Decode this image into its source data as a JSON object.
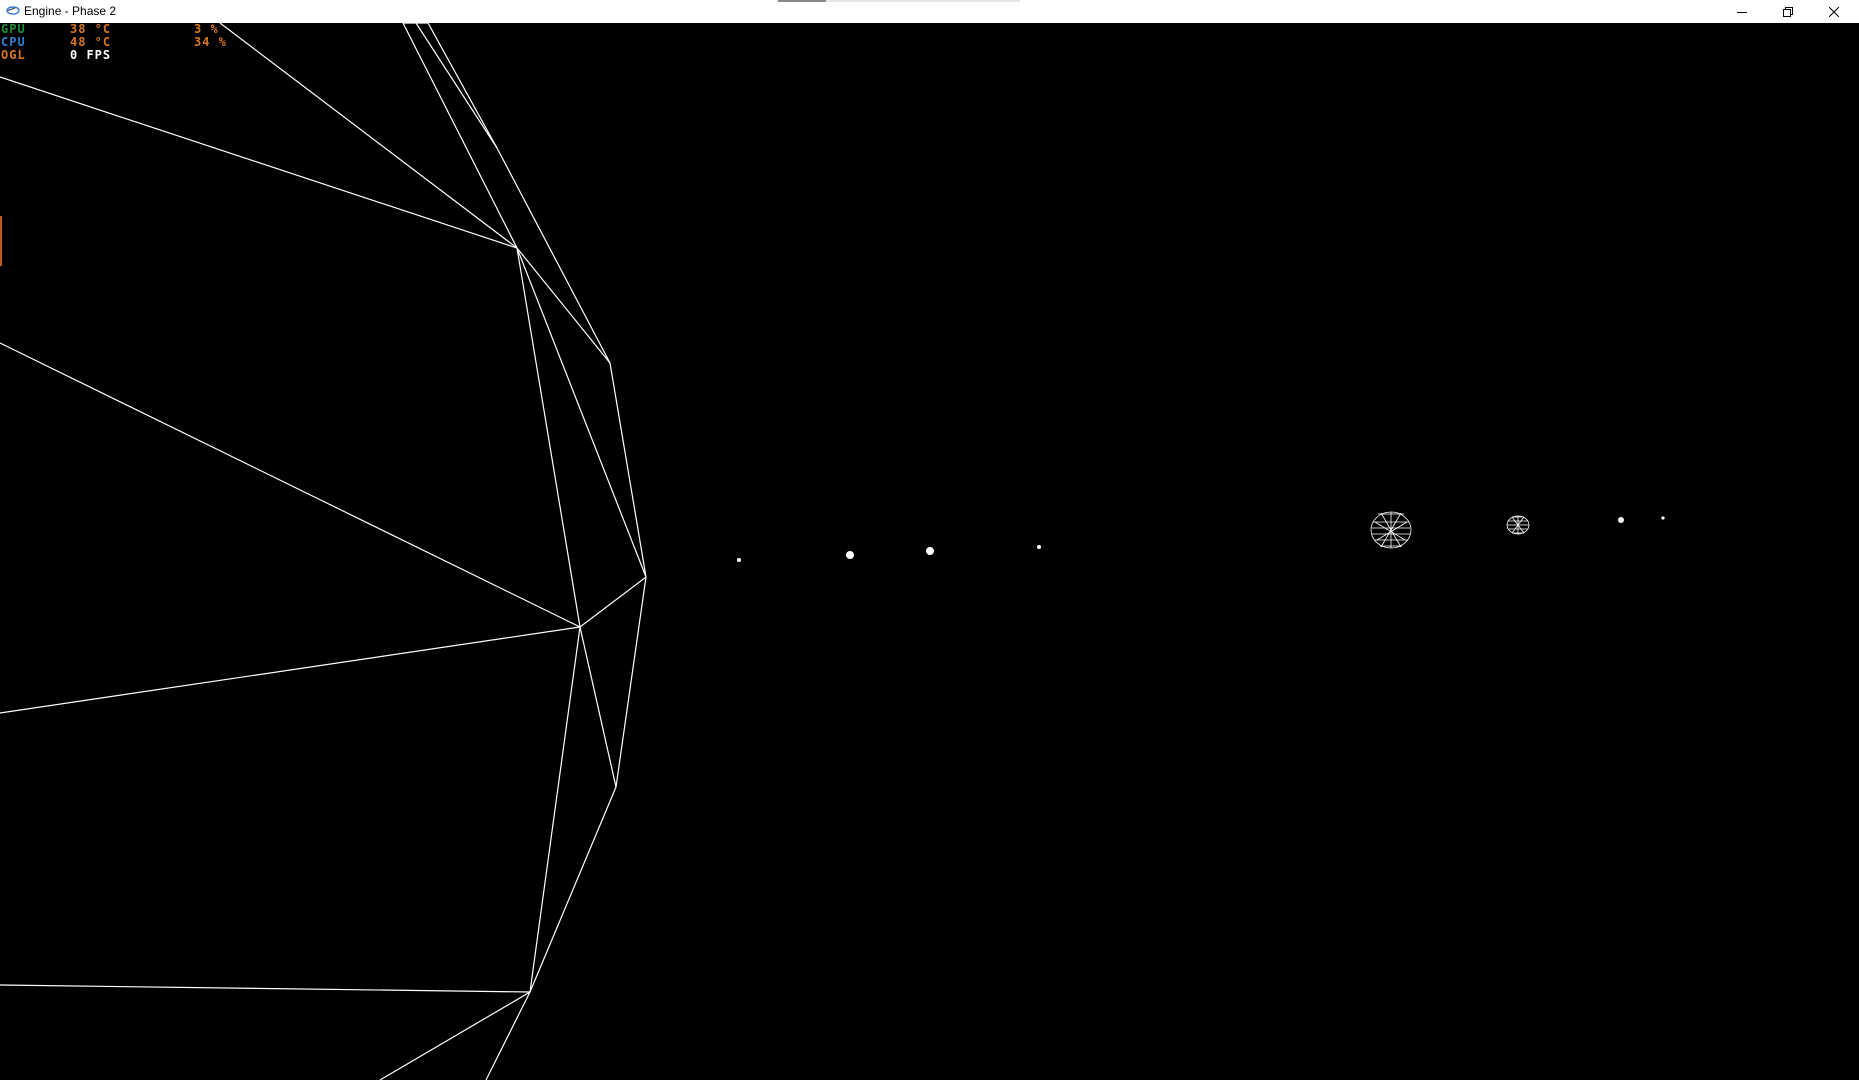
{
  "window": {
    "title": "Engine - Phase 2",
    "icon": "engine-app-icon",
    "controls": [
      "minimize-icon",
      "restore-icon",
      "close-icon"
    ]
  },
  "hud": {
    "rows": [
      {
        "label": "GPU",
        "value1": "38 °C",
        "value2": "3 %",
        "label_color": "#1f8f3a",
        "value_color": "#d9761e"
      },
      {
        "label": "CPU",
        "value1": "48 °C",
        "value2": "34 %",
        "label_color": "#2a7fd4",
        "value_color": "#d9761e"
      },
      {
        "label": "OGL",
        "value1": "0 FPS",
        "value2": "",
        "label_color": "#d9761e",
        "value_color": "#ffffff"
      }
    ]
  },
  "scene": {
    "background": "#000000",
    "line_color": "#ffffff",
    "description_objects": [
      "wireframe-sphere-large",
      "planet-dots",
      "wireframe-planet-medium",
      "wireframe-planet-small"
    ]
  }
}
